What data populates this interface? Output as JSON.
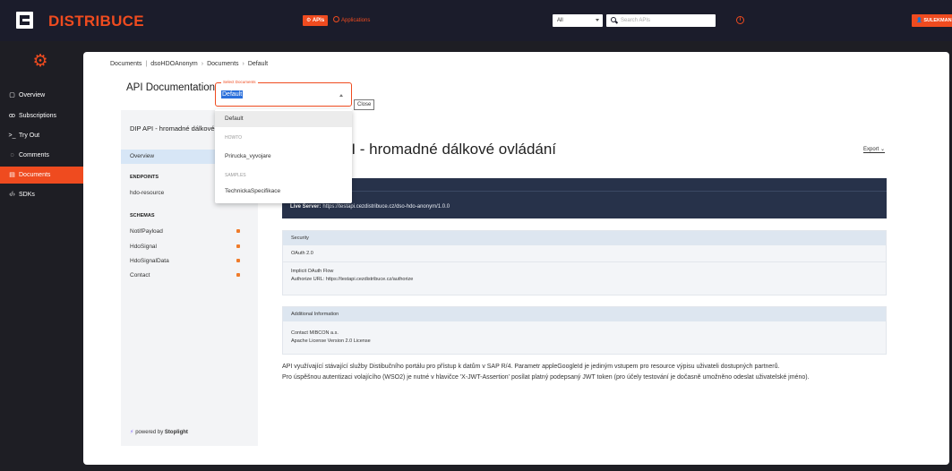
{
  "header": {
    "logo_text": "DISTRIBUCE",
    "tab_apis": "APIs",
    "tab_applications": "Applications",
    "filter_value": "All",
    "search_placeholder": "Search APIs",
    "user_label": "SULEKMAN"
  },
  "sidebar": {
    "items": [
      {
        "label": "Overview",
        "icon": "grid-icon"
      },
      {
        "label": "Subscriptions",
        "icon": "users-icon"
      },
      {
        "label": "Try Out",
        "icon": "terminal-icon"
      },
      {
        "label": "Comments",
        "icon": "comment-icon"
      },
      {
        "label": "Documents",
        "icon": "document-icon"
      },
      {
        "label": "SDKs",
        "icon": "code-icon"
      }
    ],
    "active": "Documents"
  },
  "breadcrumb": [
    "Documents",
    "dsoHDOAnonym",
    "Documents",
    "Default"
  ],
  "page_title": "API Documentation",
  "select": {
    "legend": "Select Documents",
    "value": "Default",
    "close_tooltip": "Close",
    "options": [
      {
        "type": "item",
        "label": "Default"
      },
      {
        "type": "group",
        "label": "HOWTO"
      },
      {
        "type": "item",
        "label": "Prirucka_vyvojare"
      },
      {
        "type": "group",
        "label": "SAMPLES"
      },
      {
        "type": "item",
        "label": "TechnickaSpecifikace"
      }
    ]
  },
  "left_panel": {
    "title": "DIP API - hromadné dálkové ovládání",
    "overview": "Overview",
    "endpoints_heading": "ENDPOINTS",
    "endpoints": [
      "hdo-resource"
    ],
    "schemas_heading": "SCHEMAS",
    "schemas": [
      "NotifPayload",
      "HdoSignal",
      "HdoSignalData",
      "Contact"
    ],
    "powered_prefix": "powered by",
    "powered_brand": "Stoplight"
  },
  "doc": {
    "heading": "PI - hromadné dálkové ovládání",
    "export_label": "Export",
    "live_server_label": "Live Server:",
    "live_server_url": "https://testapi.cezdistribuce.cz/dso-hdo-anonym/1.0.0",
    "security_heading": "Security",
    "security_scheme": "OAuth 2.0",
    "flow_title": "Implicit OAuth Flow",
    "authorize_url": "Authorize URL: https://testapi.cezdistribuce.cz/authorize",
    "additional_heading": "Additional Information",
    "contact": "Contact MIBCON a.s.",
    "license": "Apache License Version 2.0 License",
    "description_1": "API využívající stávající služby Distibučního portálu pro přístup k datům v SAP R/4. Parametr appleGoogleId je jediným vstupem pro resource výpisu uživateli dostupných partnerů.",
    "description_2": "Pro úspěšnou autentizaci volajícího (WSO2) je nutné v hlavičce 'X-JWT-Assertion' posílat platný podepsaný JWT token (pro účely testování je dočasně umožněno odeslat uživatelské jméno)."
  },
  "colors": {
    "brand": "#ef4b1f",
    "topbar": "#1b1c2b",
    "server_box": "#27324a"
  }
}
